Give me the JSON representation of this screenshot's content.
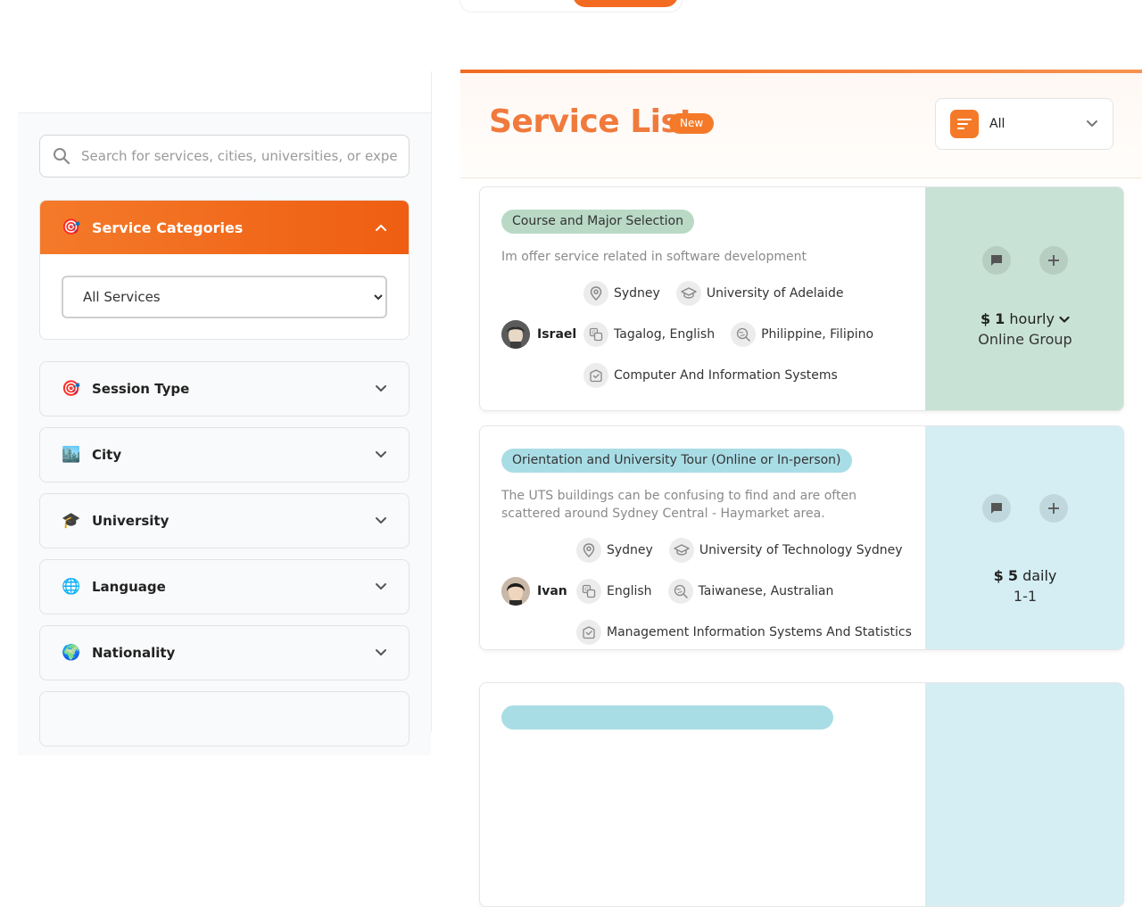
{
  "sidebar": {
    "search": {
      "placeholder": "Search for services, cities, universities, or experti"
    },
    "categories": {
      "emoji": "🎯",
      "title": "Service Categories",
      "selected": "All Services"
    },
    "filters": [
      {
        "emoji": "🎯",
        "label": "Session Type"
      },
      {
        "emoji": "🏙️",
        "label": "City"
      },
      {
        "emoji": "🎓",
        "label": "University"
      },
      {
        "emoji": "🌐",
        "label": "Language"
      },
      {
        "emoji": "🌍",
        "label": "Nationality"
      }
    ]
  },
  "main": {
    "title": "Service List",
    "badge": "New",
    "sort": {
      "selected": "All"
    },
    "cards": [
      {
        "tag": "Course and Major Selection",
        "tag_color": "#b9d9c5",
        "description": "Im offer service related in software development",
        "city": "Sydney",
        "university": "University of Adelaide",
        "provider": "Israel",
        "languages": "Tagalog, English",
        "nationality": "Philippine, Filipino",
        "major": "Computer And Information Systems",
        "price_currency": "$",
        "price_amount": "1",
        "price_unit": "hourly",
        "mode": "Online Group",
        "panel_color": "#c9e2d6"
      },
      {
        "tag": "Orientation and University Tour (Online or In-person)",
        "tag_color": "#a9dde6",
        "description": "The UTS buildings can be confusing to find and are often scattered around Sydney Central - Haymarket area.",
        "city": "Sydney",
        "university": "University of Technology Sydney",
        "provider": "Ivan",
        "languages": "English",
        "nationality": "Taiwanese, Australian",
        "major": "Management Information Systems And Statistics",
        "price_currency": "$",
        "price_amount": "5",
        "price_unit": "daily",
        "mode": "1-1",
        "panel_color": "#d4eef3"
      }
    ]
  }
}
